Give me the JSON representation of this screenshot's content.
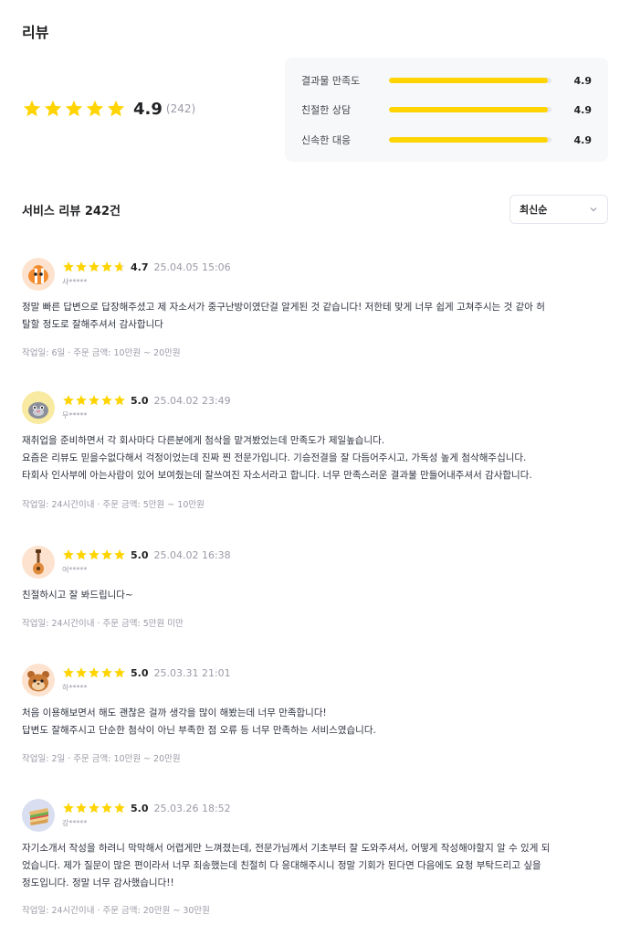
{
  "page": {
    "title": "리뷰"
  },
  "summary": {
    "stars": 5,
    "average": "4.9",
    "count": "(242)",
    "metrics": [
      {
        "label": "결과물 만족도",
        "value": "4.9",
        "fill": 0.98
      },
      {
        "label": "친절한 상담",
        "value": "4.9",
        "fill": 0.98
      },
      {
        "label": "신속한 대응",
        "value": "4.9",
        "fill": 0.98
      }
    ]
  },
  "reviews_section": {
    "heading": "서비스 리뷰 242건",
    "sort_value": "최신순"
  },
  "colors": {
    "star": "#ffd400",
    "star_empty": "#e4e5ed",
    "bar_fill": "#ffd400"
  },
  "reviews": [
    {
      "avatar": "clownfish-avatar",
      "rating": 4.7,
      "score": "4.7",
      "date": "25.04.05 15:06",
      "user": "샤*****",
      "text": "정말 빠른 답변으로 답장해주셨고 제 자소서가 중구난방이였단걸 알게된 것 같습니다! 저한테 맞게 너무 쉽게 고쳐주시는 것 같아 허\n탈할 정도로 잘해주셔서 감사합니다",
      "meta": "작업일: 6일 · 주문 금액: 10만원 ~ 20만원"
    },
    {
      "avatar": "mole-avatar",
      "rating": 5,
      "score": "5.0",
      "date": "25.04.02 23:49",
      "user": "무*****",
      "text": "재취업을 준비하면서 각 회사마다 다른분에게 첨삭을 맡겨봤었는데 만족도가 제일높습니다.\n요즘은 리뷰도 믿을수없다해서 걱정이었는데 진짜 찐 전문가입니다. 기승전결을 잘 다듬어주시고, 가독성 높게 첨삭해주십니다.\n타회사 인사부에 아는사람이 있어 보여줬는데 잘쓰여진 자소서라고 합니다. 너무 만족스러운 결과물 만들어내주셔서 감사합니다.",
      "meta": "작업일: 24시간이내 · 주문 금액: 5만원 ~ 10만원"
    },
    {
      "avatar": "guitar-avatar",
      "rating": 5,
      "score": "5.0",
      "date": "25.04.02 16:38",
      "user": "여*****",
      "text": "친절하시고 잘 봐드립니다~",
      "meta": "작업일: 24시간이내 · 주문 금액: 5만원 미만"
    },
    {
      "avatar": "hamster-avatar",
      "rating": 5,
      "score": "5.0",
      "date": "25.03.31 21:01",
      "user": "하*****",
      "text": "처음 이용해보면서 해도 괜찮은 걸까 생각을 많이 해봤는데 너무 만족합니다!\n답변도 잘해주시고 단순한 첨삭이 아닌 부족한 점 오류 등 너무 만족하는 서비스였습니다.",
      "meta": "작업일: 2일 · 주문 금액: 10만원 ~ 20만원"
    },
    {
      "avatar": "sandwich-avatar",
      "rating": 5,
      "score": "5.0",
      "date": "25.03.26 18:52",
      "user": "강*****",
      "text": "자기소개서 작성을 하려니 막막해서 어렵게만 느껴졌는데, 전문가님께서 기초부터 잘 도와주셔서, 어떻게 작성해야할지 알 수 있게 되\n었습니다. 제가 질문이 많은 편이라서 너무 죄송했는데 친절히 다 응대해주시니 정말 기회가 된다면 다음에도 요청 부탁드리고 싶을\n정도입니다. 정말 너무 감사했습니다!!",
      "meta": "작업일: 24시간이내 · 주문 금액: 20만원 ~ 30만원"
    }
  ]
}
